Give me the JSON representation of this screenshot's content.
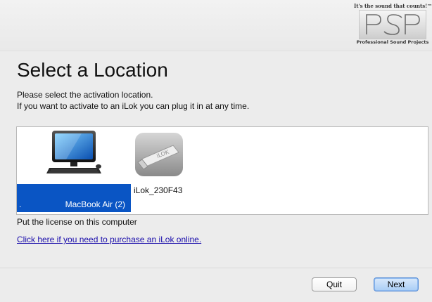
{
  "header": {
    "logo_tagline": "It's the sound that counts!™",
    "logo_mark": "PSP",
    "logo_subtitle": "Professional Sound Projects"
  },
  "page": {
    "title": "Select a Location",
    "instruction_line1": "Please select the activation location.",
    "instruction_line2": "If you want to activate to an iLok you can plug it in at any time."
  },
  "locations": [
    {
      "label": "MacBook Air (2)",
      "prefix": ".",
      "icon": "computer-icon",
      "selected": true
    },
    {
      "label": "iLok_230F43",
      "icon": "ilok-usb-key-icon",
      "selected": false
    }
  ],
  "status_text": "Put the license on this computer",
  "purchase_link": "Click here if you need to purchase an iLok online.",
  "buttons": {
    "quit": "Quit",
    "next": "Next"
  },
  "colors": {
    "selection": "#0a55c4",
    "link": "#1a0dab",
    "default_button": "#a9cdf6"
  }
}
